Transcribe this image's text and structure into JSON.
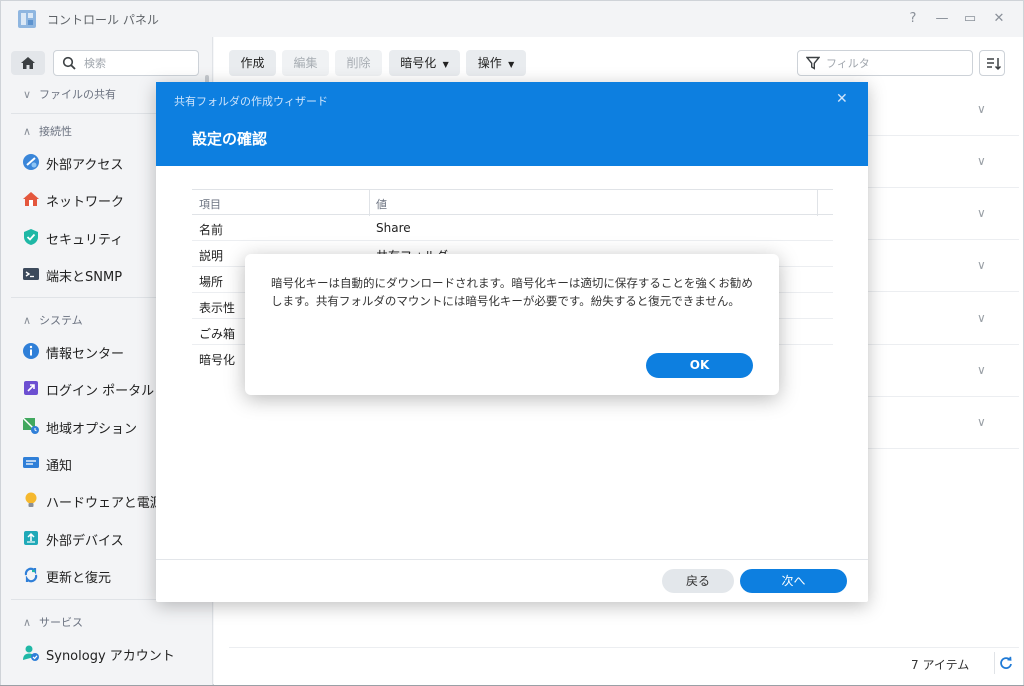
{
  "window": {
    "title": "コントロール パネル",
    "controls": [
      "?",
      "—",
      "▭",
      "✕"
    ]
  },
  "sidebar": {
    "search_placeholder": "検索",
    "sections": [
      {
        "label": "ファイルの共有",
        "expanded": false
      },
      {
        "label": "接続性",
        "expanded": true
      },
      {
        "label": "システム",
        "expanded": true
      },
      {
        "label": "サービス",
        "expanded": true
      }
    ],
    "items": [
      {
        "label": "外部アクセス",
        "icon": "external-access-icon"
      },
      {
        "label": "ネットワーク",
        "icon": "network-icon"
      },
      {
        "label": "セキュリティ",
        "icon": "security-shield-icon"
      },
      {
        "label": "端末とSNMP",
        "icon": "terminal-icon"
      },
      {
        "label": "情報センター",
        "icon": "info-icon"
      },
      {
        "label": "ログイン ポータル",
        "icon": "login-portal-icon"
      },
      {
        "label": "地域オプション",
        "icon": "regional-options-icon"
      },
      {
        "label": "通知",
        "icon": "notification-icon"
      },
      {
        "label": "ハードウェアと電源",
        "icon": "hardware-power-icon"
      },
      {
        "label": "外部デバイス",
        "icon": "external-device-icon"
      },
      {
        "label": "更新と復元",
        "icon": "update-restore-icon"
      },
      {
        "label": "Synology アカウント",
        "icon": "synology-account-icon"
      }
    ]
  },
  "toolbar": {
    "create": "作成",
    "edit": "編集",
    "delete": "削除",
    "encrypt": "暗号化",
    "action": "操作",
    "filter_placeholder": "フィルタ"
  },
  "footer": {
    "item_count": "7 アイテム"
  },
  "wizard": {
    "window_title": "共有フォルダの作成ウィザード",
    "step_title": "設定の確認",
    "table": {
      "headers": [
        "項目",
        "値"
      ],
      "rows": [
        [
          "名前",
          "Share"
        ],
        [
          "説明",
          "共有フォルダ"
        ],
        [
          "場所",
          ""
        ],
        [
          "表示性",
          ""
        ],
        [
          "ごみ箱",
          ""
        ],
        [
          "暗号化",
          ""
        ]
      ]
    },
    "back_label": "戻る",
    "next_label": "次へ"
  },
  "alert": {
    "message": "暗号化キーは自動的にダウンロードされます。暗号化キーは適切に保存することを強くお勧めします。共有フォルダのマウントには暗号化キーが必要です。紛失すると復元できません。",
    "ok_label": "OK"
  },
  "colors": {
    "accent": "#0d7fe0",
    "dialog_header": "#0d7fe0"
  }
}
